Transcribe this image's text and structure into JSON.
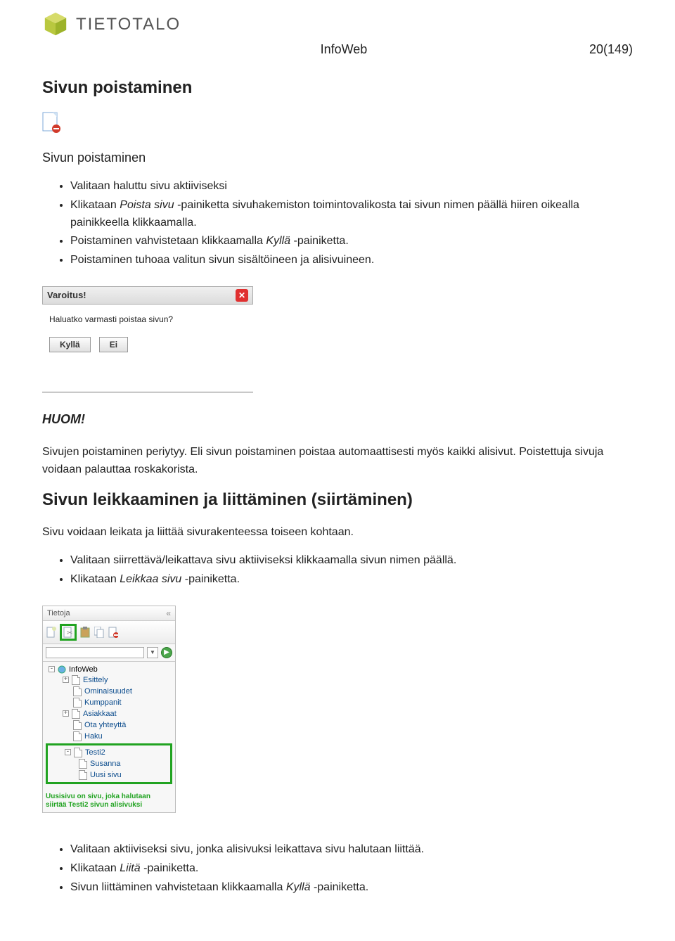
{
  "logo": {
    "brand": "TIETOTALO"
  },
  "header": {
    "center": "InfoWeb",
    "right": "20(149)"
  },
  "section1": {
    "title": "Sivun poistaminen",
    "subtitle": "Sivun poistaminen",
    "bullets": [
      {
        "pre": "Valitaan haluttu sivu aktiiviseksi"
      },
      {
        "text": "Klikataan ",
        "em1": "Poista sivu",
        "mid": " -painiketta sivuhakemiston toimintovalikosta tai sivun nimen päällä hiiren oikealla painikkeella klikkaamalla."
      },
      {
        "text": "Poistaminen vahvistetaan klikkaamalla ",
        "em1": "Kyllä",
        "mid": " -painiketta."
      },
      {
        "pre": "Poistaminen tuhoaa valitun sivun sisältöineen ja alisivuineen."
      }
    ]
  },
  "dialog": {
    "title": "Varoitus!",
    "body": "Haluatko varmasti poistaa sivun?",
    "yes": "Kyllä",
    "no": "Ei"
  },
  "huom": {
    "label": "HUOM!",
    "p": "Sivujen poistaminen periytyy. Eli sivun poistaminen poistaa automaattisesti myös kaikki alisivut. Poistettuja sivuja voidaan palauttaa roskakorista."
  },
  "section2": {
    "title": "Sivun leikkaaminen ja liittäminen (siirtäminen)",
    "intro": "Sivu voidaan leikata ja liittää sivurakenteessa toiseen kohtaan.",
    "bullets": [
      {
        "pre": "Valitaan siirrettävä/leikattava sivu aktiiviseksi klikkaamalla sivun nimen päällä."
      },
      {
        "text": "Klikataan ",
        "em1": "Leikkaa sivu",
        "mid": " -painiketta."
      }
    ]
  },
  "panel": {
    "title": "Tietoja",
    "collapse": "«",
    "tree": {
      "root": "InfoWeb",
      "items": [
        {
          "label": "Esittely",
          "expandable": true
        },
        {
          "label": "Ominaisuudet",
          "expandable": false
        },
        {
          "label": "Kumppanit",
          "expandable": false
        },
        {
          "label": "Asiakkaat",
          "expandable": true
        },
        {
          "label": "Ota yhteyttä",
          "expandable": false
        },
        {
          "label": "Haku",
          "expandable": false
        }
      ],
      "hl": {
        "parent": "Testi2",
        "children": [
          "Susanna",
          "Uusi sivu"
        ]
      }
    },
    "caption": "Uusisivu on sivu, joka halutaan siirtää Testi2 sivun alisivuksi"
  },
  "section3": {
    "bullets": [
      {
        "pre": "Valitaan aktiiviseksi sivu, jonka alisivuksi leikattava sivu halutaan liittää."
      },
      {
        "text": "Klikataan ",
        "em1": "Liitä",
        "mid": " -painiketta."
      },
      {
        "text": "Sivun liittäminen vahvistetaan klikkaamalla ",
        "em1": "Kyllä",
        "mid": " -painiketta."
      }
    ]
  }
}
